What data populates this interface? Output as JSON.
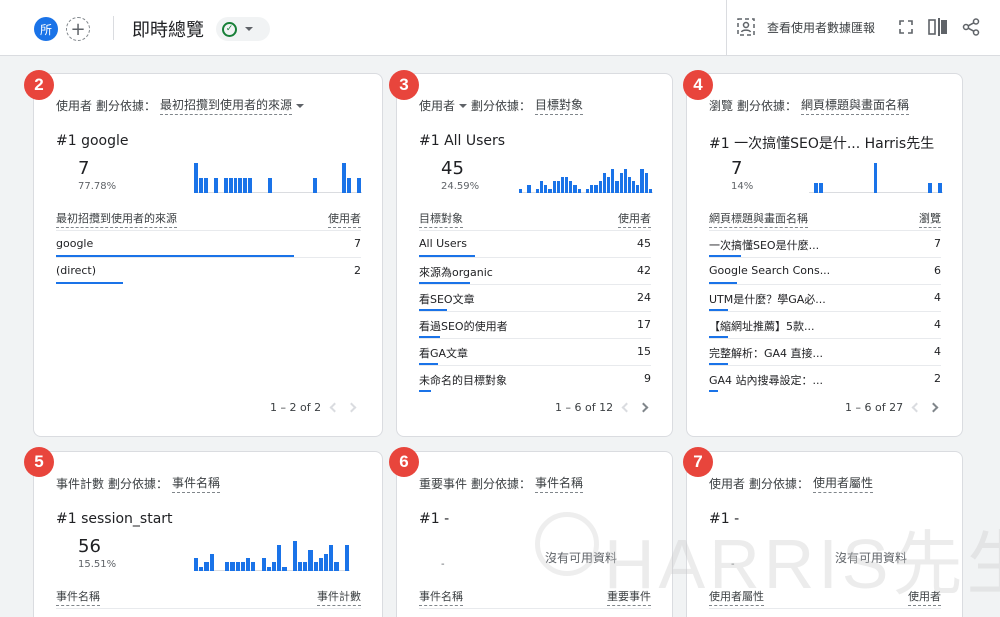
{
  "header": {
    "property_avatar": "所",
    "add_symbol": "+",
    "title": "即時總覽",
    "compare_label": "查看使用者數據匯報",
    "status_icon": "check-circle-icon"
  },
  "badges": [
    "2",
    "3",
    "4",
    "5",
    "6",
    "7"
  ],
  "cards": [
    {
      "metric": "使用者",
      "dimension_prefix": "劃分依據：",
      "dimension": "最初招攬到使用者的來源",
      "top_rank": "#1  google",
      "top_value": "7",
      "top_percent": "77.78%",
      "spark": [
        4,
        2,
        2,
        0,
        2,
        0,
        2,
        2,
        2,
        2,
        2,
        2,
        0,
        0,
        0,
        2,
        0,
        0,
        0,
        0,
        0,
        0,
        0,
        0,
        2,
        0,
        0,
        0,
        0,
        0,
        4,
        2,
        0,
        2
      ],
      "col_label": "最初招攬到使用者的來源",
      "col_value": "使用者",
      "rows": [
        {
          "label": "google",
          "value": "7",
          "share": 0.78
        },
        {
          "label": "(direct)",
          "value": "2",
          "share": 0.22
        }
      ],
      "pager": "1 – 2 of 2"
    },
    {
      "metric": "使用者",
      "dimension_prefix": "劃分依據：",
      "dimension": "目標對象",
      "top_rank": "#1  All Users",
      "top_value": "45",
      "top_percent": "24.59%",
      "spark": [
        1,
        0,
        2,
        0,
        1,
        3,
        2,
        1,
        3,
        3,
        4,
        4,
        3,
        2,
        1,
        0,
        1,
        2,
        2,
        3,
        5,
        4,
        6,
        3,
        5,
        6,
        4,
        3,
        2,
        6,
        5,
        1
      ],
      "col_label": "目標對象",
      "col_value": "使用者",
      "rows": [
        {
          "label": "All Users",
          "value": "45",
          "share": 0.24
        },
        {
          "label": "來源為organic",
          "value": "42",
          "share": 0.22
        },
        {
          "label": "看SEO文章",
          "value": "24",
          "share": 0.12
        },
        {
          "label": "看過SEO的使用者",
          "value": "17",
          "share": 0.09
        },
        {
          "label": "看GA文章",
          "value": "15",
          "share": 0.08
        },
        {
          "label": "未命名的目標對象",
          "value": "9",
          "share": 0.05
        }
      ],
      "pager": "1 – 6 of 12"
    },
    {
      "metric": "瀏覽",
      "dimension_prefix": "劃分依據：",
      "dimension": "網頁標題與畫面名稱",
      "top_rank": "#1  一次搞懂SEO是什... Harris先生",
      "top_value": "7",
      "top_percent": "14%",
      "spark": [
        0,
        1,
        1,
        0,
        0,
        0,
        0,
        0,
        0,
        0,
        0,
        0,
        0,
        3,
        0,
        0,
        0,
        0,
        0,
        0,
        0,
        0,
        0,
        0,
        1,
        0,
        1
      ],
      "col_label": "網頁標題與畫面名稱",
      "col_value": "瀏覽",
      "rows": [
        {
          "label": "一次搞懂SEO是什麼...",
          "value": "7",
          "share": 0.14
        },
        {
          "label": "Google Search Cons...",
          "value": "6",
          "share": 0.12
        },
        {
          "label": "UTM是什麼？學GA必...",
          "value": "4",
          "share": 0.08
        },
        {
          "label": "【縮網址推薦】5款...",
          "value": "4",
          "share": 0.08
        },
        {
          "label": "完整解析：GA4 直接...",
          "value": "4",
          "share": 0.08
        },
        {
          "label": "GA4 站內搜尋設定：...",
          "value": "2",
          "share": 0.04
        }
      ],
      "pager": "1 – 6 of 27"
    },
    {
      "metric": "事件計數",
      "dimension_prefix": "劃分依據：",
      "dimension": "事件名稱",
      "top_rank": "#1  session_start",
      "top_value": "56",
      "top_percent": "15.51%",
      "spark": [
        3,
        1,
        2,
        4,
        0,
        0,
        2,
        2,
        2,
        2,
        3,
        2,
        0,
        3,
        1,
        2,
        6,
        1,
        0,
        7,
        2,
        2,
        5,
        2,
        3,
        4,
        6,
        2,
        0,
        6
      ],
      "col_label": "事件名稱",
      "col_value": "事件計數",
      "rows": []
    },
    {
      "metric": "重要事件",
      "dimension_prefix": "劃分依據：",
      "dimension": "事件名稱",
      "top_rank": "#1  -",
      "top_value": "-",
      "no_data": "沒有可用資料",
      "col_label": "事件名稱",
      "col_value": "重要事件",
      "rows": []
    },
    {
      "metric": "使用者",
      "dimension_prefix": "劃分依據：",
      "dimension": "使用者屬性",
      "top_rank": "#1  -",
      "top_value": "-",
      "no_data": "沒有可用資料",
      "col_label": "使用者屬性",
      "col_value": "使用者",
      "rows": []
    }
  ],
  "watermark": "HARRIS先生",
  "colors": {
    "accent": "#1a73e8",
    "badge": "#e8453c",
    "ok": "#188038"
  }
}
